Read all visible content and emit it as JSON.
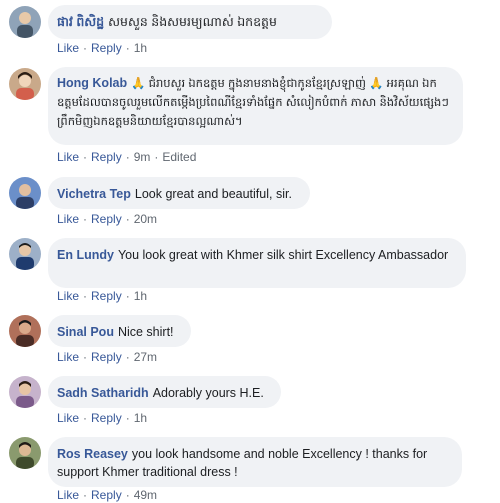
{
  "comments": [
    {
      "author": "ផាវ ពិសិដ្ឋ",
      "text": "សមសួន និងសមរម្យណាស់ ឯកឧត្តម",
      "like": "Like",
      "reply": "Reply",
      "time": "1h",
      "edited": "",
      "avatar_color": "#6b7f95"
    },
    {
      "author": "Hong Kolab",
      "text": "🙏 ជំរាបសួរ ឯកឧត្តម ក្នុងនាមនាងខ្ញុំជាកូនខ្មែរស្រឡាញ់ 🙏 អរគុណ ឯកឧត្តមដែលបានចូលរួមលើកតម្កើងប្រពៃណីខ្មែរទាំងផ្នែក សំលៀកបំពាក់ ភាសា និងវិស័យផ្សេងៗ ព្រឹកមិញឯកឧត្តមនិយាយខ្មែរបានល្អណាស់។",
      "like": "Like",
      "reply": "Reply",
      "time": "9m",
      "edited": "Edited",
      "avatar_color": "#8a6d57"
    },
    {
      "author": "Vichetra Tep",
      "text": "Look great and beautiful, sir.",
      "like": "Like",
      "reply": "Reply",
      "time": "20m",
      "edited": "",
      "avatar_color": "#5a7bb0"
    },
    {
      "author": "En Lundy",
      "text": "You look great with Khmer silk shirt Excellency Ambassador",
      "like": "Like",
      "reply": "Reply",
      "time": "1h",
      "edited": "",
      "avatar_color": "#3d5a80"
    },
    {
      "author": "Sinal Pou",
      "text": "Nice shirt!",
      "like": "Like",
      "reply": "Reply",
      "time": "27m",
      "edited": "",
      "avatar_color": "#7a4b3a"
    },
    {
      "author": "Sadh Satharidh",
      "text": "Adorably yours H.E.",
      "like": "Like",
      "reply": "Reply",
      "time": "1h",
      "edited": "",
      "avatar_color": "#9a7aa0"
    },
    {
      "author": "Ros Reasey",
      "text": "you look handsome and noble Excellency ! thanks for support Khmer traditional dress !",
      "like": "Like",
      "reply": "Reply",
      "time": "49m",
      "edited": "",
      "avatar_color": "#5c6b4a"
    }
  ],
  "colors": {
    "author": "#385898",
    "bubble": "#f0f2f5",
    "meta": "#606770"
  }
}
